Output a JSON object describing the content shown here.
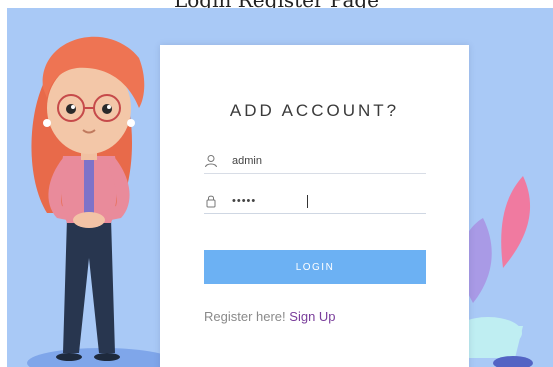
{
  "caption": "Login Register Page",
  "card": {
    "title": "ADD ACCOUNT?",
    "username": {
      "icon": "user-icon",
      "value": "admin"
    },
    "password": {
      "icon": "lock-icon",
      "value": "•••••"
    },
    "login_label": "LOGIN",
    "register_text": "Register here!",
    "signup_link": "Sign Up"
  },
  "colors": {
    "background": "#a9c9f6",
    "card": "#ffffff",
    "button": "#6cb1f3",
    "link": "#7a3e9b"
  }
}
